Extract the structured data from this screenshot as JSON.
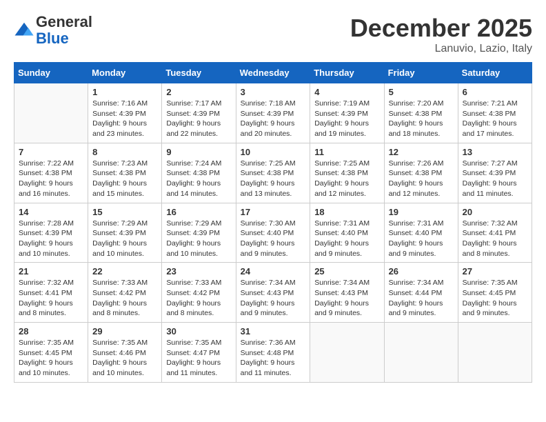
{
  "header": {
    "logo_general": "General",
    "logo_blue": "Blue",
    "month": "December 2025",
    "location": "Lanuvio, Lazio, Italy"
  },
  "days_of_week": [
    "Sunday",
    "Monday",
    "Tuesday",
    "Wednesday",
    "Thursday",
    "Friday",
    "Saturday"
  ],
  "weeks": [
    [
      {
        "day": "",
        "data": ""
      },
      {
        "day": "1",
        "data": "Sunrise: 7:16 AM\nSunset: 4:39 PM\nDaylight: 9 hours and 23 minutes."
      },
      {
        "day": "2",
        "data": "Sunrise: 7:17 AM\nSunset: 4:39 PM\nDaylight: 9 hours and 22 minutes."
      },
      {
        "day": "3",
        "data": "Sunrise: 7:18 AM\nSunset: 4:39 PM\nDaylight: 9 hours and 20 minutes."
      },
      {
        "day": "4",
        "data": "Sunrise: 7:19 AM\nSunset: 4:39 PM\nDaylight: 9 hours and 19 minutes."
      },
      {
        "day": "5",
        "data": "Sunrise: 7:20 AM\nSunset: 4:38 PM\nDaylight: 9 hours and 18 minutes."
      },
      {
        "day": "6",
        "data": "Sunrise: 7:21 AM\nSunset: 4:38 PM\nDaylight: 9 hours and 17 minutes."
      }
    ],
    [
      {
        "day": "7",
        "data": "Sunrise: 7:22 AM\nSunset: 4:38 PM\nDaylight: 9 hours and 16 minutes."
      },
      {
        "day": "8",
        "data": "Sunrise: 7:23 AM\nSunset: 4:38 PM\nDaylight: 9 hours and 15 minutes."
      },
      {
        "day": "9",
        "data": "Sunrise: 7:24 AM\nSunset: 4:38 PM\nDaylight: 9 hours and 14 minutes."
      },
      {
        "day": "10",
        "data": "Sunrise: 7:25 AM\nSunset: 4:38 PM\nDaylight: 9 hours and 13 minutes."
      },
      {
        "day": "11",
        "data": "Sunrise: 7:25 AM\nSunset: 4:38 PM\nDaylight: 9 hours and 12 minutes."
      },
      {
        "day": "12",
        "data": "Sunrise: 7:26 AM\nSunset: 4:38 PM\nDaylight: 9 hours and 12 minutes."
      },
      {
        "day": "13",
        "data": "Sunrise: 7:27 AM\nSunset: 4:39 PM\nDaylight: 9 hours and 11 minutes."
      }
    ],
    [
      {
        "day": "14",
        "data": "Sunrise: 7:28 AM\nSunset: 4:39 PM\nDaylight: 9 hours and 10 minutes."
      },
      {
        "day": "15",
        "data": "Sunrise: 7:29 AM\nSunset: 4:39 PM\nDaylight: 9 hours and 10 minutes."
      },
      {
        "day": "16",
        "data": "Sunrise: 7:29 AM\nSunset: 4:39 PM\nDaylight: 9 hours and 10 minutes."
      },
      {
        "day": "17",
        "data": "Sunrise: 7:30 AM\nSunset: 4:40 PM\nDaylight: 9 hours and 9 minutes."
      },
      {
        "day": "18",
        "data": "Sunrise: 7:31 AM\nSunset: 4:40 PM\nDaylight: 9 hours and 9 minutes."
      },
      {
        "day": "19",
        "data": "Sunrise: 7:31 AM\nSunset: 4:40 PM\nDaylight: 9 hours and 9 minutes."
      },
      {
        "day": "20",
        "data": "Sunrise: 7:32 AM\nSunset: 4:41 PM\nDaylight: 9 hours and 8 minutes."
      }
    ],
    [
      {
        "day": "21",
        "data": "Sunrise: 7:32 AM\nSunset: 4:41 PM\nDaylight: 9 hours and 8 minutes."
      },
      {
        "day": "22",
        "data": "Sunrise: 7:33 AM\nSunset: 4:42 PM\nDaylight: 9 hours and 8 minutes."
      },
      {
        "day": "23",
        "data": "Sunrise: 7:33 AM\nSunset: 4:42 PM\nDaylight: 9 hours and 8 minutes."
      },
      {
        "day": "24",
        "data": "Sunrise: 7:34 AM\nSunset: 4:43 PM\nDaylight: 9 hours and 9 minutes."
      },
      {
        "day": "25",
        "data": "Sunrise: 7:34 AM\nSunset: 4:43 PM\nDaylight: 9 hours and 9 minutes."
      },
      {
        "day": "26",
        "data": "Sunrise: 7:34 AM\nSunset: 4:44 PM\nDaylight: 9 hours and 9 minutes."
      },
      {
        "day": "27",
        "data": "Sunrise: 7:35 AM\nSunset: 4:45 PM\nDaylight: 9 hours and 9 minutes."
      }
    ],
    [
      {
        "day": "28",
        "data": "Sunrise: 7:35 AM\nSunset: 4:45 PM\nDaylight: 9 hours and 10 minutes."
      },
      {
        "day": "29",
        "data": "Sunrise: 7:35 AM\nSunset: 4:46 PM\nDaylight: 9 hours and 10 minutes."
      },
      {
        "day": "30",
        "data": "Sunrise: 7:35 AM\nSunset: 4:47 PM\nDaylight: 9 hours and 11 minutes."
      },
      {
        "day": "31",
        "data": "Sunrise: 7:36 AM\nSunset: 4:48 PM\nDaylight: 9 hours and 11 minutes."
      },
      {
        "day": "",
        "data": ""
      },
      {
        "day": "",
        "data": ""
      },
      {
        "day": "",
        "data": ""
      }
    ]
  ]
}
